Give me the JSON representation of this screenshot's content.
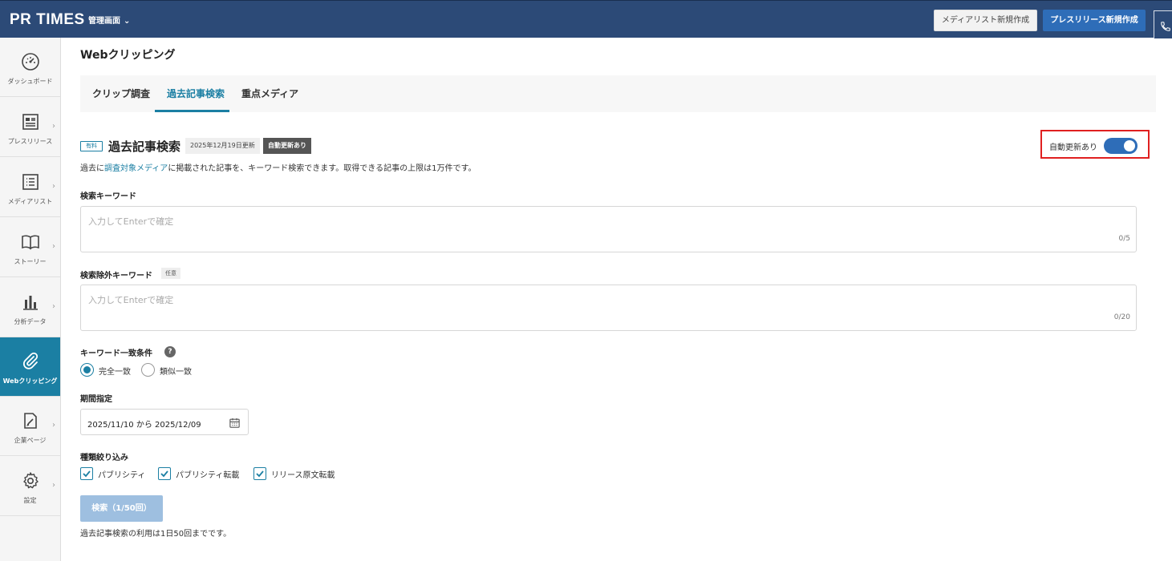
{
  "header": {
    "logo": "PR TIMES",
    "admin_menu": "管理画面",
    "media_list_button": "メディアリスト新規作成",
    "release_button": "プレスリリース新規作成"
  },
  "sidebar": {
    "items": [
      {
        "label": "ダッシュボード",
        "icon": "dashboard-icon"
      },
      {
        "label": "プレスリリース",
        "icon": "press-release-icon"
      },
      {
        "label": "メディアリスト",
        "icon": "list-icon"
      },
      {
        "label": "ストーリー",
        "icon": "book-icon"
      },
      {
        "label": "分析データ",
        "icon": "bar-chart-icon"
      },
      {
        "label": "Webクリッピング",
        "icon": "paperclip-icon",
        "active": true
      },
      {
        "label": "企業ページ",
        "icon": "edit-page-icon"
      },
      {
        "label": "設定",
        "icon": "gear-icon"
      }
    ]
  },
  "main": {
    "page_title": "Webクリッピング",
    "tabs": [
      {
        "label": "クリップ調査"
      },
      {
        "label": "過去記事検索",
        "active": true
      },
      {
        "label": "重点メディア"
      }
    ],
    "section": {
      "paid_badge": "有料",
      "title": "過去記事検索",
      "updated": "2025年12月19日更新",
      "auto_badge": "自動更新あり",
      "description_pre": "過去に",
      "description_link": "調査対象メディア",
      "description_post": "に掲載された記事を、キーワード検索できます。取得できる記事の上限は1万件です。"
    },
    "auto_update": {
      "label": "自動更新あり",
      "on": true
    },
    "keyword": {
      "label": "検索キーワード",
      "placeholder": "入力してEnterで確定",
      "count": "0/5"
    },
    "exclude_keyword": {
      "label": "検索除外キーワード",
      "optional_tag": "任意",
      "placeholder": "入力してEnterで確定",
      "count": "0/20"
    },
    "match": {
      "label": "キーワード一致条件",
      "help": "?",
      "options": [
        {
          "label": "完全一致",
          "selected": true
        },
        {
          "label": "類似一致",
          "selected": false
        }
      ]
    },
    "period": {
      "label": "期間指定",
      "value": "2025/11/10 から 2025/12/09"
    },
    "types": {
      "label": "種類絞り込み",
      "options": [
        {
          "label": "パブリシティ",
          "checked": true
        },
        {
          "label": "パブリシティ転載",
          "checked": true
        },
        {
          "label": "リリース原文転載",
          "checked": true
        }
      ]
    },
    "search_button": "検索（1/50回）",
    "note": "過去記事検索の利用は1日50回までです。"
  },
  "colors": {
    "header_bg": "#2c4a77",
    "accent": "#1b7fa3",
    "primary_button": "#2e6db8",
    "highlight_border": "#e02020"
  }
}
